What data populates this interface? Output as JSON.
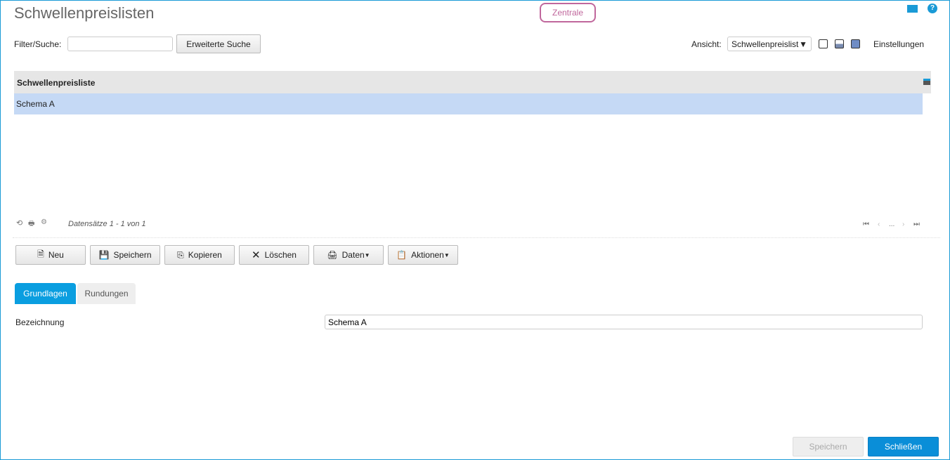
{
  "header": {
    "title": "Schwellenpreislisten",
    "badge": "Zentrale"
  },
  "filter": {
    "label": "Filter/Suche:",
    "value": "",
    "advanced_button": "Erweiterte Suche"
  },
  "view": {
    "label": "Ansicht:",
    "selected": "Schwellenpreislist",
    "settings": "Einstellungen"
  },
  "grid": {
    "column": "Schwellenpreisliste",
    "rows": [
      "Schema A"
    ],
    "record_info": "Datensätze 1 - 1 von 1",
    "pager_ellipsis": "..."
  },
  "toolbar": {
    "new": "Neu",
    "save": "Speichern",
    "copy": "Kopieren",
    "delete": "Löschen",
    "data": "Daten",
    "actions": "Aktionen"
  },
  "tabs": [
    {
      "label": "Grundlagen",
      "active": true
    },
    {
      "label": "Rundungen",
      "active": false
    }
  ],
  "form": {
    "bezeichnung_label": "Bezeichnung",
    "bezeichnung_value": "Schema A"
  },
  "footer": {
    "save": "Speichern",
    "close": "Schließen"
  },
  "colors": {
    "accent": "#0a9ee0",
    "selected_row": "#c5d9f5",
    "badge": "#c0679c"
  }
}
